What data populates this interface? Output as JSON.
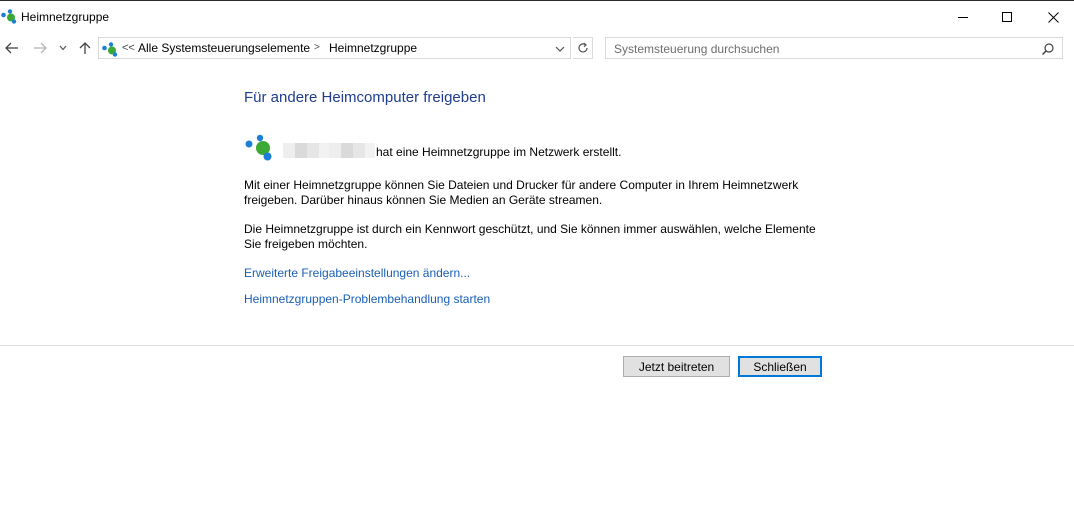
{
  "window": {
    "title": "Heimnetzgruppe",
    "controls": {
      "minimize": "minimize-icon",
      "maximize": "maximize-icon",
      "close": "close-icon"
    }
  },
  "navigation": {
    "back_icon": "arrow-left-icon",
    "forward_icon": "arrow-right-icon",
    "recent_icon": "chevron-down-icon",
    "up_icon": "arrow-up-icon",
    "breadcrumb": {
      "overflow": "<<",
      "items": [
        "Alle Systemsteuerungselemente",
        "Heimnetzgruppe"
      ],
      "separator": ">"
    },
    "refresh_icon": "refresh-icon",
    "search": {
      "placeholder": "Systemsteuerung durchsuchen",
      "icon": "search-icon"
    }
  },
  "content": {
    "heading": "Für andere Heimcomputer freigeben",
    "created_text": "hat eine Heimnetzgruppe im Netzwerk erstellt.",
    "paragraph1_line1": "Mit einer Heimnetzgruppe können Sie Dateien und Drucker für andere Computer in Ihrem Heimnetzwerk",
    "paragraph1_line2": "freigeben. Darüber hinaus können Sie Medien an Geräte streamen.",
    "paragraph2_line1": "Die Heimnetzgruppe ist durch ein Kennwort geschützt, und Sie können immer auswählen, welche Elemente",
    "paragraph2_line2": "Sie freigeben möchten.",
    "links": {
      "advanced_sharing": "Erweiterte Freigabeeinstellungen ändern...",
      "troubleshoot": "Heimnetzgruppen-Problembehandlung starten"
    }
  },
  "buttons": {
    "join": "Jetzt beitreten",
    "close": "Schließen"
  },
  "colors": {
    "heading": "#1e3d8f",
    "link": "#1a5fb4",
    "focus_border": "#0078d7",
    "icon_green": "#3aa935",
    "icon_blue": "#1c7fd6"
  }
}
